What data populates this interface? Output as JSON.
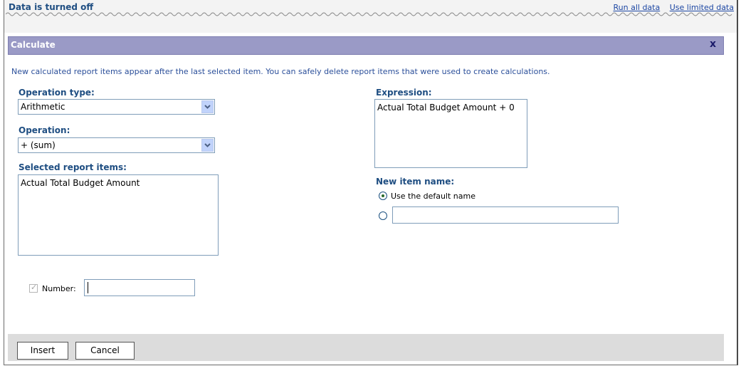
{
  "databar": {
    "status": "Data is turned off",
    "links": [
      "Run all data",
      "Use limited data"
    ]
  },
  "dialog": {
    "title": "Calculate",
    "close_glyph": "x",
    "intro": "New calculated report items appear after the last selected item. You can safely delete report items that were used to create calculations.",
    "operation_type": {
      "label": "Operation type:",
      "value": "Arithmetic"
    },
    "operation": {
      "label": "Operation:",
      "value": "+ (sum)"
    },
    "selected_items": {
      "label": "Selected report items:",
      "items": [
        "Actual Total Budget Amount"
      ]
    },
    "number": {
      "label": "Number:",
      "checked": true,
      "value": ""
    },
    "expression": {
      "label": "Expression:",
      "value": "Actual Total Budget Amount + 0"
    },
    "new_item_name": {
      "label": "New item name:",
      "default_option": "Use the default name",
      "custom_value": ""
    },
    "buttons": {
      "insert": "Insert",
      "cancel": "Cancel"
    }
  }
}
